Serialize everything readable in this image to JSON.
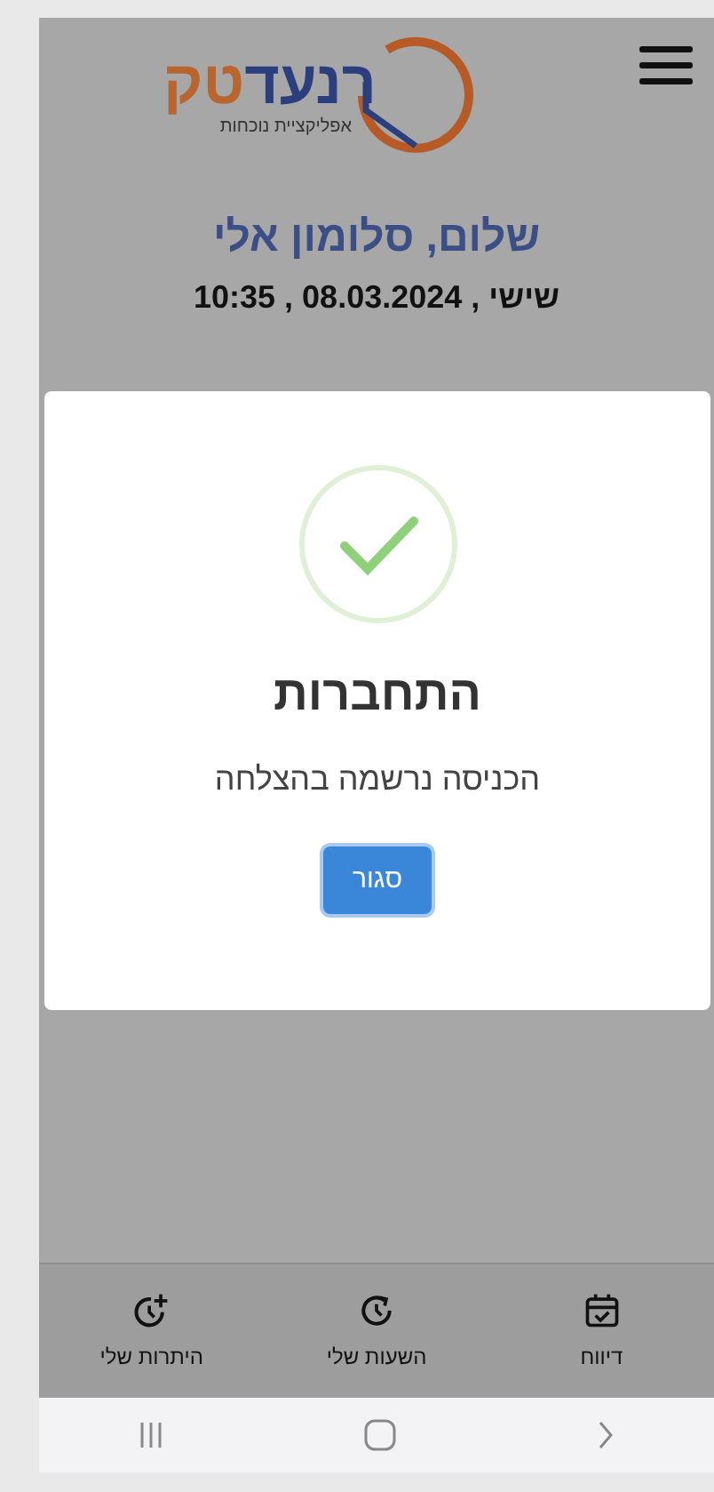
{
  "header": {
    "logo": {
      "part_1": "רנעד",
      "part_2": "טק",
      "tagline": "אפליקציית נוכחות"
    }
  },
  "greeting": "שלום, סלומון אלי",
  "datetime": "שישי , 08.03.2024 , 10:35",
  "dialog": {
    "title": "התחברות",
    "message": "הכניסה נרשמה בהצלחה",
    "button": "סגור"
  },
  "bottom_nav": [
    {
      "label": "דיווח",
      "kind": "calendar"
    },
    {
      "label": "השעות שלי",
      "kind": "clock"
    },
    {
      "label": "היתרות שלי",
      "kind": "clock-plus"
    }
  ]
}
